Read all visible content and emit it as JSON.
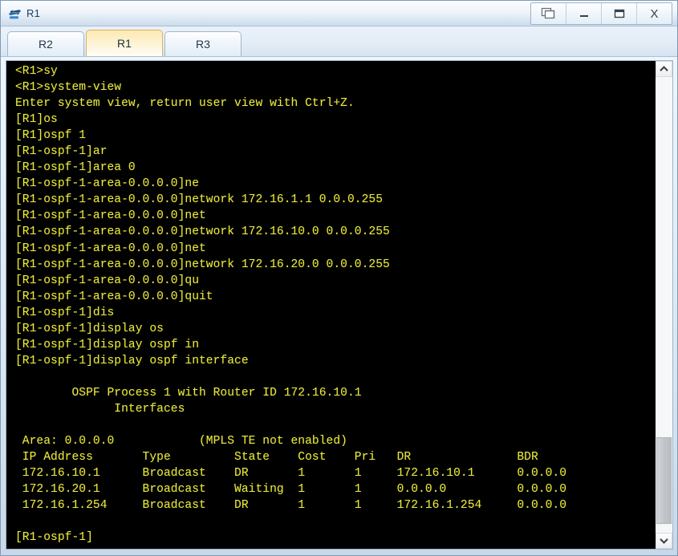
{
  "window": {
    "title": "R1",
    "icon": "router-icon",
    "controls": [
      {
        "name": "restore-windows-button",
        "label": ""
      },
      {
        "name": "minimize-button",
        "label": ""
      },
      {
        "name": "maximize-button",
        "label": ""
      },
      {
        "name": "close-button",
        "label": "X"
      }
    ]
  },
  "tabs": [
    {
      "label": "R2",
      "active": false
    },
    {
      "label": "R1",
      "active": true
    },
    {
      "label": "R3",
      "active": false
    }
  ],
  "terminal": {
    "foreground_color": "#e8e83c",
    "background_color": "#000000",
    "lines": [
      "<R1>sy",
      "<R1>system-view",
      "Enter system view, return user view with Ctrl+Z.",
      "[R1]os",
      "[R1]ospf 1",
      "[R1-ospf-1]ar",
      "[R1-ospf-1]area 0",
      "[R1-ospf-1-area-0.0.0.0]ne",
      "[R1-ospf-1-area-0.0.0.0]network 172.16.1.1 0.0.0.255",
      "[R1-ospf-1-area-0.0.0.0]net",
      "[R1-ospf-1-area-0.0.0.0]network 172.16.10.0 0.0.0.255",
      "[R1-ospf-1-area-0.0.0.0]net",
      "[R1-ospf-1-area-0.0.0.0]network 172.16.20.0 0.0.0.255",
      "[R1-ospf-1-area-0.0.0.0]qu",
      "[R1-ospf-1-area-0.0.0.0]quit",
      "[R1-ospf-1]dis",
      "[R1-ospf-1]display os",
      "[R1-ospf-1]display ospf in",
      "[R1-ospf-1]display ospf interface",
      "",
      "        OSPF Process 1 with Router ID 172.16.10.1",
      "              Interfaces",
      "",
      " Area: 0.0.0.0            (MPLS TE not enabled)",
      " IP Address       Type         State    Cost    Pri   DR               BDR",
      " 172.16.10.1      Broadcast    DR       1       1     172.16.10.1      0.0.0.0",
      " 172.16.20.1      Broadcast    Waiting  1       1     0.0.0.0          0.0.0.0",
      " 172.16.1.254     Broadcast    DR       1       1     172.16.1.254     0.0.0.0",
      "",
      "[R1-ospf-1]"
    ],
    "ospf_report": {
      "header": "OSPF Process 1 with Router ID 172.16.10.1",
      "subheader": "Interfaces",
      "area": "Area: 0.0.0.0",
      "mpls_note": "(MPLS TE not enabled)",
      "columns": [
        "IP Address",
        "Type",
        "State",
        "Cost",
        "Pri",
        "DR",
        "BDR"
      ],
      "rows": [
        [
          "172.16.10.1",
          "Broadcast",
          "DR",
          "1",
          "1",
          "172.16.10.1",
          "0.0.0.0"
        ],
        [
          "172.16.20.1",
          "Broadcast",
          "Waiting",
          "1",
          "1",
          "0.0.0.0",
          "0.0.0.0"
        ],
        [
          "172.16.1.254",
          "Broadcast",
          "DR",
          "1",
          "1",
          "172.16.1.254",
          "0.0.0.0"
        ]
      ]
    },
    "prompt": "[R1-ospf-1]"
  },
  "scrollbar": {
    "up_arrow": "⌃",
    "down_arrow": "⌄",
    "thumb_top_pct": 79,
    "thumb_height_pct": 19
  }
}
